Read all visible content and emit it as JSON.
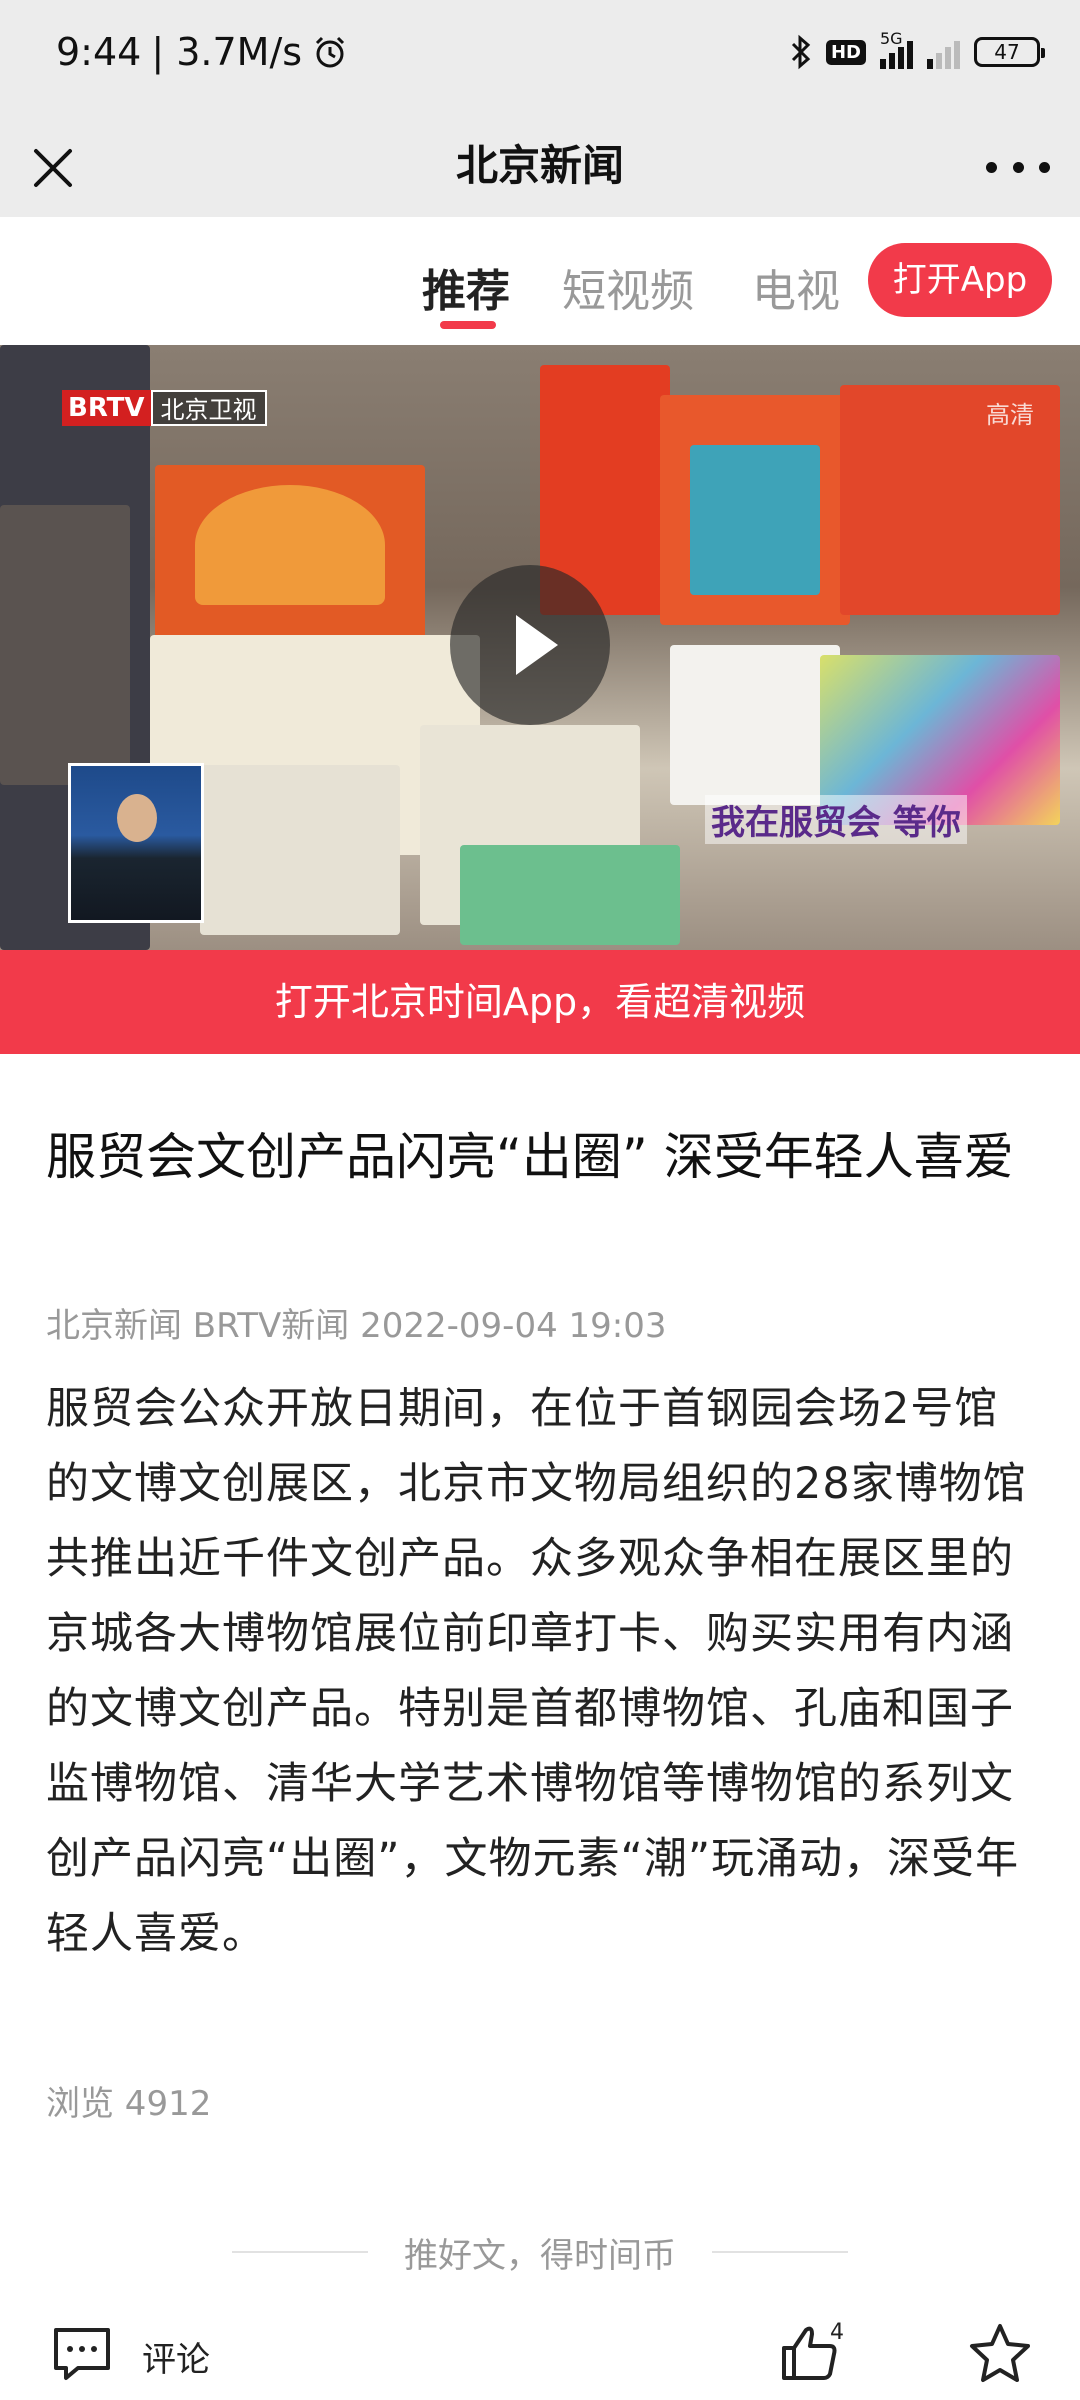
{
  "status_bar": {
    "time": "9:44",
    "net_speed": "| 3.7M/s",
    "hd_label": "HD",
    "network": "5G",
    "battery": "47"
  },
  "nav": {
    "title": "北京新闻"
  },
  "tabs": [
    {
      "label": "推荐",
      "active": true
    },
    {
      "label": "短视频",
      "active": false
    },
    {
      "label": "电视",
      "active": false
    }
  ],
  "open_app_button": "打开App",
  "video": {
    "logo_brtv": "BRTV",
    "logo_channel": "北京卫视",
    "quality": "高清",
    "overlay_text": "我在服贸会 等你"
  },
  "app_banner": "打开北京时间App，看超清视频",
  "article": {
    "title": "服贸会文创产品闪亮“出圈” 深受年轻人喜爱",
    "meta": "北京新闻 BRTV新闻 2022-09-04 19:03",
    "body": "服贸会公众开放日期间，在位于首钢园会场2号馆的文博文创展区，北京市文物局组织的28家博物馆共推出近千件文创产品。众多观众争相在展区里的京城各大博物馆展位前印章打卡、购买实用有内涵的文博文创产品。特别是首都博物馆、孔庙和国子监博物馆、清华大学艺术博物馆等博物馆的系列文创产品闪亮“出圈”，文物元素“潮”玩涌动，深受年轻人喜爱。",
    "views": "浏览 4912"
  },
  "promo": "推好文，得时间币",
  "bottom_bar": {
    "comment_label": "评论",
    "like_count": "4"
  },
  "colors": {
    "accent": "#f23a4a",
    "nav_bg": "#ececec"
  }
}
